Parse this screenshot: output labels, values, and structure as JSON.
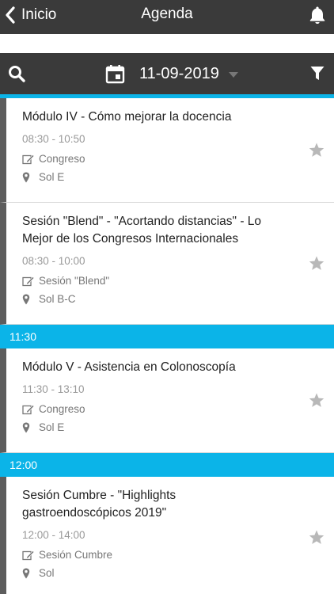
{
  "header": {
    "back_label": "Inicio",
    "title": "Agenda"
  },
  "filter": {
    "date": "11-09-2019"
  },
  "colors": {
    "bar": "#3a3a3a",
    "accent": "#0bb4e8",
    "timeline": "#5d5d5d"
  },
  "icons": [
    "chevron-left-icon",
    "bell-icon",
    "search-icon",
    "calendar-icon",
    "caret-down-icon",
    "filter-icon",
    "edit-icon",
    "map-pin-icon",
    "star-icon"
  ],
  "blocks": [
    {
      "time_header": "",
      "sessions": [
        {
          "title": "Módulo IV - Cómo mejorar la docencia",
          "time": "08:30 - 10:50",
          "type": "Congreso",
          "room": "Sol E"
        },
        {
          "title": "Sesión \"Blend\" - \"Acortando distancias\" - Lo Mejor de los Congresos Internacionales",
          "time": "08:30 - 10:00",
          "type": "Sesión \"Blend\"",
          "room": "Sol B-C"
        }
      ]
    },
    {
      "time_header": "11:30",
      "sessions": [
        {
          "title": "Módulo V - Asistencia en Colonoscopía",
          "time": "11:30 - 13:10",
          "type": "Congreso",
          "room": "Sol E"
        }
      ]
    },
    {
      "time_header": "12:00",
      "sessions": [
        {
          "title": "Sesión Cumbre - \"Highlights gastroendoscópicos 2019\"",
          "time": "12:00 - 14:00",
          "type": "Sesión Cumbre",
          "room": "Sol"
        }
      ]
    }
  ]
}
